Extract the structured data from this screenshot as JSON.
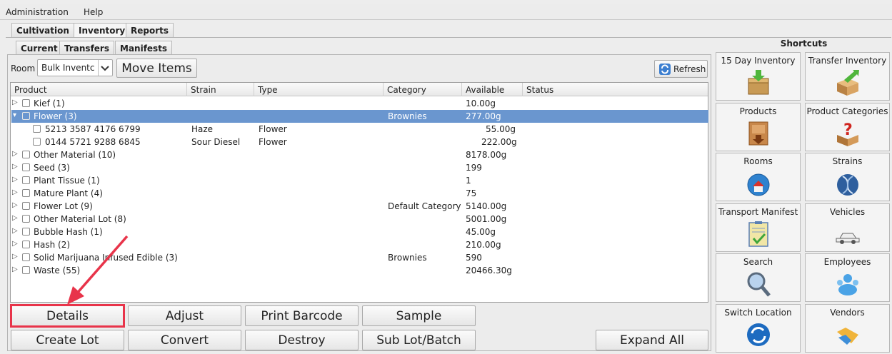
{
  "menu": [
    "Administration",
    "Help"
  ],
  "main_tabs": [
    "Cultivation",
    "Inventory",
    "Reports"
  ],
  "sub_tabs": [
    "Current",
    "Transfers",
    "Manifests"
  ],
  "room": {
    "label": "Room",
    "value": "Bulk Inventc"
  },
  "move_items_label": "Move Items",
  "refresh_label": "Refresh",
  "columns": [
    "Product",
    "Strain",
    "Type",
    "Category",
    "Available",
    "Status"
  ],
  "rows": [
    {
      "product": "Kief (1)",
      "strain": "",
      "type": "",
      "category": "",
      "available": "10.00g",
      "status": ""
    },
    {
      "product": "Flower (3)",
      "strain": "",
      "type": "",
      "category": "Brownies",
      "available": "277.00g",
      "status": ""
    },
    {
      "product": "5213 3587 4176 6799",
      "strain": "Haze",
      "type": "Flower",
      "category": "",
      "available": "55.00g",
      "status": ""
    },
    {
      "product": "0144 5721 9288 6845",
      "strain": "Sour Diesel",
      "type": "Flower",
      "category": "",
      "available": "222.00g",
      "status": ""
    },
    {
      "product": "Other Material (10)",
      "strain": "",
      "type": "",
      "category": "",
      "available": "8178.00g",
      "status": ""
    },
    {
      "product": "Seed (3)",
      "strain": "",
      "type": "",
      "category": "",
      "available": "199",
      "status": ""
    },
    {
      "product": "Plant Tissue (1)",
      "strain": "",
      "type": "",
      "category": "",
      "available": "1",
      "status": ""
    },
    {
      "product": "Mature Plant (4)",
      "strain": "",
      "type": "",
      "category": "",
      "available": "75",
      "status": ""
    },
    {
      "product": "Flower Lot (9)",
      "strain": "",
      "type": "",
      "category": "Default Category",
      "available": "5140.00g",
      "status": ""
    },
    {
      "product": "Other Material Lot (8)",
      "strain": "",
      "type": "",
      "category": "",
      "available": "5001.00g",
      "status": ""
    },
    {
      "product": "Bubble Hash (1)",
      "strain": "",
      "type": "",
      "category": "",
      "available": "45.00g",
      "status": ""
    },
    {
      "product": "Hash (2)",
      "strain": "",
      "type": "",
      "category": "",
      "available": "210.00g",
      "status": ""
    },
    {
      "product": "Solid Marijuana Infused Edible (3)",
      "strain": "",
      "type": "",
      "category": "Brownies",
      "available": "590",
      "status": ""
    },
    {
      "product": "Waste (55)",
      "strain": "",
      "type": "",
      "category": "",
      "available": "20466.30g",
      "status": ""
    }
  ],
  "buttons": {
    "details": "Details",
    "adjust": "Adjust",
    "print_barcode": "Print Barcode",
    "sample": "Sample",
    "create_lot": "Create Lot",
    "convert": "Convert",
    "destroy": "Destroy",
    "sub_lot": "Sub Lot/Batch",
    "expand_all": "Expand All"
  },
  "shortcuts_title": "Shortcuts",
  "shortcuts": [
    {
      "label": "15 Day Inventory",
      "icon": "box-download-icon"
    },
    {
      "label": "Transfer Inventory",
      "icon": "box-arrow-icon"
    },
    {
      "label": "Products",
      "icon": "product-box-icon"
    },
    {
      "label": "Product Categories",
      "icon": "question-box-icon"
    },
    {
      "label": "Rooms",
      "icon": "house-globe-icon"
    },
    {
      "label": "Strains",
      "icon": "dna-icon"
    },
    {
      "label": "Transport Manifest",
      "icon": "clipboard-check-icon"
    },
    {
      "label": "Vehicles",
      "icon": "car-icon"
    },
    {
      "label": "Search",
      "icon": "magnifier-icon"
    },
    {
      "label": "Employees",
      "icon": "people-icon"
    },
    {
      "label": "Switch Location",
      "icon": "refresh-globe-icon"
    },
    {
      "label": "Vendors",
      "icon": "handshake-icon"
    }
  ],
  "colors": {
    "selected_row": "#6a96cf",
    "annotation": "#e8344a"
  }
}
